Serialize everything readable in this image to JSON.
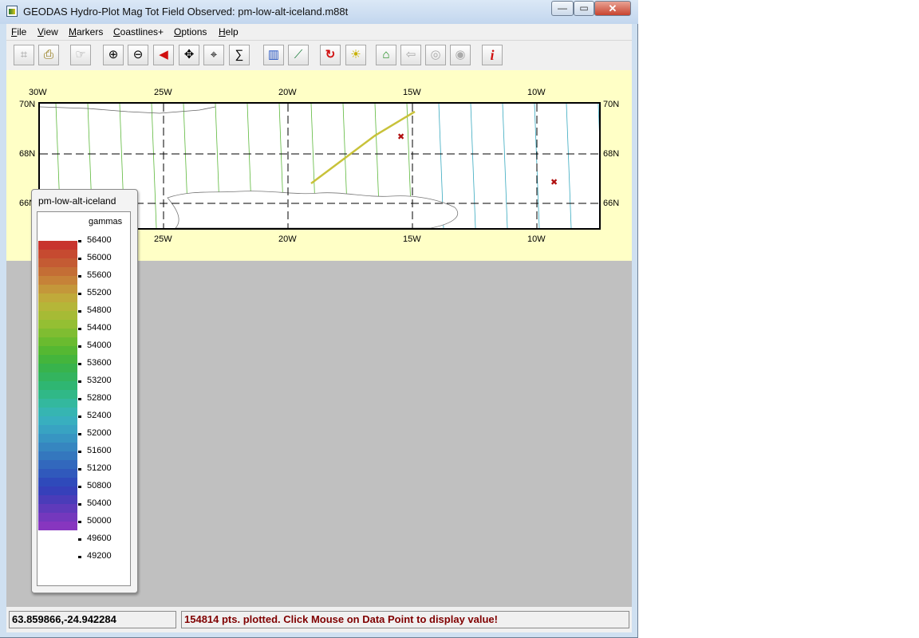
{
  "window": {
    "title": "GEODAS Hydro-Plot Mag Tot Field Observed: pm-low-alt-iceland.m88t",
    "min_glyph": "—",
    "max_glyph": "▭",
    "close_glyph": "✕"
  },
  "menu": [
    {
      "label": "File",
      "u": "F",
      "rest": "ile"
    },
    {
      "label": "View",
      "u": "V",
      "rest": "iew"
    },
    {
      "label": "Markers",
      "u": "M",
      "rest": "arkers"
    },
    {
      "label": "Coastlines+",
      "u": "C",
      "rest": "oastlines+"
    },
    {
      "label": "Options",
      "u": "O",
      "rest": "ptions"
    },
    {
      "label": "Help",
      "u": "H",
      "rest": "elp"
    }
  ],
  "toolbar": [
    {
      "name": "select-icon",
      "glyph": "⌗",
      "enabled": false
    },
    {
      "name": "print-icon",
      "glyph": "⎙",
      "enabled": true
    },
    {
      "name": "pointer-hand-icon",
      "glyph": "☞",
      "enabled": false
    },
    {
      "name": "zoom-in-icon",
      "glyph": "⊕",
      "enabled": true
    },
    {
      "name": "zoom-out-icon",
      "glyph": "⊖",
      "enabled": true
    },
    {
      "name": "back-arrow-icon",
      "glyph": "◀",
      "enabled": true
    },
    {
      "name": "pan-icon",
      "glyph": "✥",
      "enabled": true
    },
    {
      "name": "crosshair-icon",
      "glyph": "⌖",
      "enabled": true
    },
    {
      "name": "sum-icon",
      "glyph": "∑",
      "enabled": true
    },
    {
      "name": "bar-chart-icon",
      "glyph": "▥",
      "enabled": true
    },
    {
      "name": "line-chart-icon",
      "glyph": "⟋",
      "enabled": true
    },
    {
      "name": "refresh-icon",
      "glyph": "↻",
      "enabled": true
    },
    {
      "name": "lightbulb-icon",
      "glyph": "☀",
      "enabled": true
    },
    {
      "name": "outline-icon",
      "glyph": "⌂",
      "enabled": true
    },
    {
      "name": "left-arrow-disabled-icon",
      "glyph": "⇦",
      "enabled": false
    },
    {
      "name": "gps-icon",
      "glyph": "◎",
      "enabled": false
    },
    {
      "name": "target-icon",
      "glyph": "◉",
      "enabled": false
    },
    {
      "name": "info-icon",
      "glyph": "i",
      "enabled": true
    }
  ],
  "map": {
    "lon_top": [
      "30W",
      "25W",
      "20W",
      "15W",
      "10W"
    ],
    "lon_bottom": [
      "25W",
      "20W",
      "15W",
      "10W"
    ],
    "lat_left": [
      "70N",
      "68N",
      "66N"
    ],
    "lat_right": [
      "70N",
      "68N",
      "66N"
    ],
    "marker_glyph": "✖"
  },
  "legend": {
    "title": "pm-low-alt-iceland",
    "unit": "gammas",
    "labels": [
      "56400",
      "56000",
      "55600",
      "55200",
      "54800",
      "54400",
      "54000",
      "53600",
      "53200",
      "52800",
      "52400",
      "52000",
      "51600",
      "51200",
      "50800",
      "50400",
      "50000",
      "49600",
      "49200"
    ],
    "colors": [
      "#c8342e",
      "#c64a30",
      "#c45b33",
      "#c46e35",
      "#c68238",
      "#c4973a",
      "#c0aa3a",
      "#b5b638",
      "#a6bb35",
      "#94bf33",
      "#7fbd31",
      "#6abb2f",
      "#55b832",
      "#44b53c",
      "#38b34c",
      "#33b45e",
      "#2fb672",
      "#30b887",
      "#33b89e",
      "#36b5b2",
      "#38afbf",
      "#38a3c2",
      "#3795c2",
      "#3686c0",
      "#3477be",
      "#3268bd",
      "#3059bc",
      "#2f4abb",
      "#3640ba",
      "#4a3cb9",
      "#5f3abb",
      "#7438bd",
      "#8736bf"
    ]
  },
  "status": {
    "coords": "63.859866,-24.942284",
    "message": "154814 pts. plotted.  Click Mouse on Data Point to display value!"
  }
}
